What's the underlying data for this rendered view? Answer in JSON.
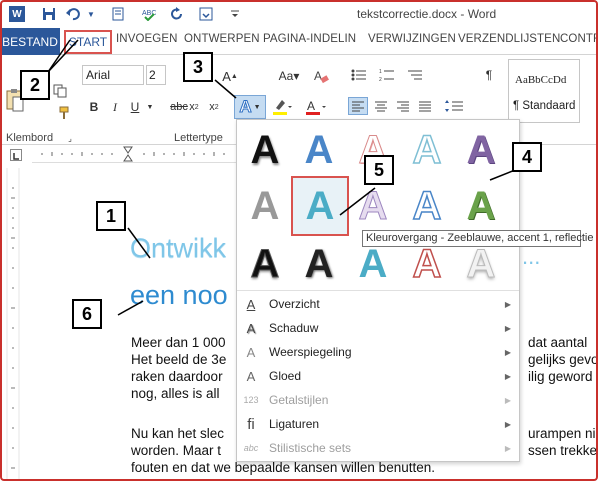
{
  "window": {
    "title": "tekstcorrectie.docx - Word"
  },
  "tabs": [
    {
      "id": "file",
      "label": "BESTAND"
    },
    {
      "id": "home",
      "label": "START"
    },
    {
      "id": "insert",
      "label": "INVOEGEN"
    },
    {
      "id": "design",
      "label": "ONTWERPEN"
    },
    {
      "id": "layout",
      "label": "PAGINA-INDELIN"
    },
    {
      "id": "references",
      "label": "VERWIJZINGEN"
    },
    {
      "id": "mailings",
      "label": "VERZENDLIJSTEN"
    },
    {
      "id": "review",
      "label": "CONTR"
    }
  ],
  "ribbon": {
    "font_name": "Arial",
    "font_size": "2",
    "groups": {
      "clipboard": "Klembord",
      "font": "Lettertype"
    },
    "style_preview": "AaBbCcDd",
    "style_name": "¶ Standaard"
  },
  "document": {
    "heading1": "Ontwikk",
    "heading2": "een noo",
    "heading_tail": "...",
    "lines": [
      {
        "left": "Meer dan 1 000",
        "right": "dat aantal"
      },
      {
        "left": "Het beeld de 3e",
        "right": "gelijks gevo"
      },
      {
        "left": "raken daardoor",
        "right": "ilig geword"
      },
      {
        "left": "nog, alles is all",
        "right": ""
      }
    ],
    "para2": [
      {
        "left": "Nu kan het slec",
        "right": "urampen ni"
      },
      {
        "left": "worden. Maar t",
        "right": "ssen trekke"
      },
      {
        "left": "fouten en dat we bepaalde kansen willen benutten.",
        "right": ""
      }
    ]
  },
  "gallery": {
    "tooltip": "Kleurovergang - Zeeblauwe, accent 1, reflectie",
    "menu": [
      {
        "icon": "A",
        "label": "Overzicht",
        "enabled": true
      },
      {
        "icon": "A",
        "label": "Schaduw",
        "enabled": true
      },
      {
        "icon": "A",
        "label": "Weerspiegeling",
        "enabled": true
      },
      {
        "icon": "A",
        "label": "Gloed",
        "enabled": true
      },
      {
        "icon": "123",
        "label": "Getalstijlen",
        "enabled": false
      },
      {
        "icon": "fi",
        "label": "Ligaturen",
        "enabled": true
      },
      {
        "icon": "abc",
        "label": "Stilistische sets",
        "enabled": false
      }
    ]
  },
  "callouts": [
    "1",
    "2",
    "3",
    "4",
    "5",
    "6"
  ],
  "colors": {
    "accent": "#2b579a",
    "highlight": "#d9534f"
  }
}
